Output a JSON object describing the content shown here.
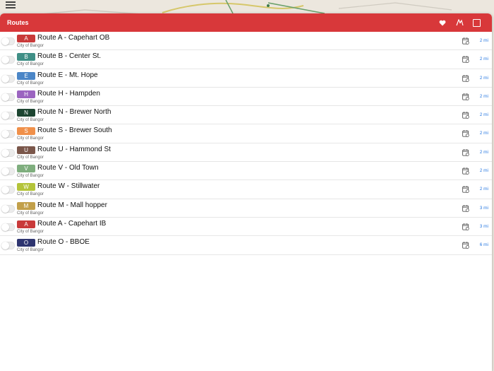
{
  "header": {
    "title": "Routes",
    "favorite_icon": "heart-icon",
    "transit_icon": "transit-icon",
    "expand_icon": "square-icon",
    "color": "#d8383a"
  },
  "routes": [
    {
      "code": "A",
      "name": "Route A - Capehart OB",
      "agency": "City of Bangor",
      "distance": "2 mi",
      "color": "#c93a3a"
    },
    {
      "code": "B",
      "name": "Route B - Center St.",
      "agency": "City of Bangor",
      "distance": "2 mi",
      "color": "#3f8f86"
    },
    {
      "code": "E",
      "name": "Route E - Mt. Hope",
      "agency": "City of Bangor",
      "distance": "2 mi",
      "color": "#4b86c7"
    },
    {
      "code": "H",
      "name": "Route H - Hampden",
      "agency": "City of Bangor",
      "distance": "2 mi",
      "color": "#9b64c0"
    },
    {
      "code": "N",
      "name": "Route N - Brewer North",
      "agency": "City of Bangor",
      "distance": "2 mi",
      "color": "#1c4430"
    },
    {
      "code": "S",
      "name": "Route S - Brewer South",
      "agency": "City of Bangor",
      "distance": "2 mi",
      "color": "#f0904a"
    },
    {
      "code": "U",
      "name": "Route U - Hammond St",
      "agency": "City of Bangor",
      "distance": "2 mi",
      "color": "#7a564a"
    },
    {
      "code": "V",
      "name": "Route V - Old Town",
      "agency": "City of Bangor",
      "distance": "2 mi",
      "color": "#7fae7e"
    },
    {
      "code": "W",
      "name": "Route W - Stillwater",
      "agency": "City of Bangor",
      "distance": "2 mi",
      "color": "#b4c43a"
    },
    {
      "code": "M",
      "name": "Route M - Mall hopper",
      "agency": "City of Bangor",
      "distance": "3 mi",
      "color": "#c2a04a"
    },
    {
      "code": "A",
      "name": "Route A - Capehart IB",
      "agency": "City of Bangor",
      "distance": "3 mi",
      "color": "#c93a3a"
    },
    {
      "code": "O",
      "name": "Route O - BBOE",
      "agency": "City of Bangor",
      "distance": "6 mi",
      "color": "#2e3570"
    }
  ]
}
